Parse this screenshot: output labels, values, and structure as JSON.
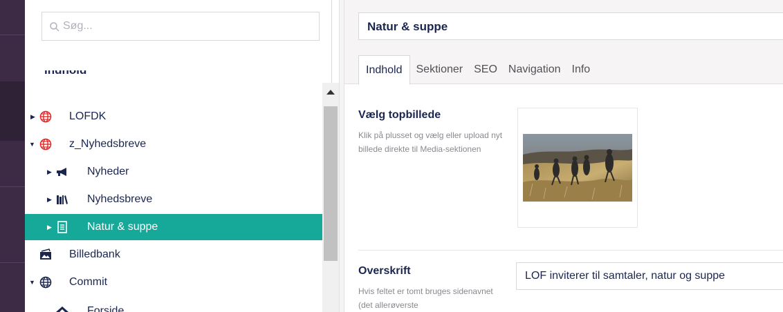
{
  "search": {
    "placeholder": "Søg..."
  },
  "tree": {
    "section_label": "Indhold",
    "nodes": [
      {
        "label": "LOFDK",
        "icon": "globe-icon",
        "color": "#e32a2a",
        "expanded": false,
        "depth": 0,
        "has_children": true
      },
      {
        "label": "z_Nyhedsbreve",
        "icon": "globe-icon",
        "color": "#e32a2a",
        "expanded": true,
        "depth": 0,
        "has_children": true
      },
      {
        "label": "Nyheder",
        "icon": "megaphone-icon",
        "depth": 1,
        "has_children": true
      },
      {
        "label": "Nyhedsbreve",
        "icon": "books-icon",
        "depth": 1,
        "has_children": true
      },
      {
        "label": "Natur & suppe",
        "icon": "document-icon",
        "depth": 1,
        "has_children": true,
        "active": true
      },
      {
        "label": "Billedbank",
        "icon": "photo-stack-icon",
        "depth": 0,
        "has_children": false
      },
      {
        "label": "Commit",
        "icon": "globe-icon",
        "color": "#1b264f",
        "expanded": true,
        "depth": 0,
        "has_children": true
      },
      {
        "label": "Forside",
        "icon": "home-icon",
        "depth": 1,
        "has_children": false
      }
    ]
  },
  "editor": {
    "node_name": "Natur & suppe",
    "tabs": [
      {
        "label": "Indhold",
        "active": true
      },
      {
        "label": "Sektioner"
      },
      {
        "label": "SEO"
      },
      {
        "label": "Navigation"
      },
      {
        "label": "Info"
      }
    ],
    "topimage": {
      "title": "Vælg topbillede",
      "description": "Klik på plusset og vælg eller upload nyt billede direkte til Media-sektionen"
    },
    "heading": {
      "title": "Overskrift",
      "description": "Hvis feltet er tomt bruges sidenavnet (det allerøverste",
      "value": "LOF inviterer til samtaler, natur og suppe"
    }
  },
  "colors": {
    "accent": "#16a99a",
    "rail": "#3d2b46",
    "text": "#1b264f",
    "globe_red": "#e32a2a"
  }
}
